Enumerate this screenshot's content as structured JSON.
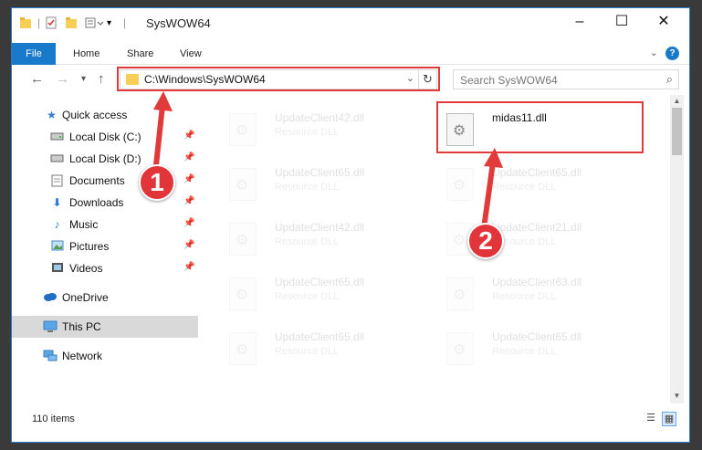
{
  "window": {
    "title": "SysWOW64",
    "tabs": [
      "File",
      "Home",
      "Share",
      "View"
    ],
    "help": "?"
  },
  "nav": {
    "address_path": "C:\\Windows\\SysWOW64",
    "search_placeholder": "Search SysWOW64"
  },
  "sidebar": {
    "items": [
      {
        "label": "Quick access",
        "icon": "star-icon"
      },
      {
        "label": "Local Disk (C:)",
        "icon": "drive-icon",
        "pinned": true
      },
      {
        "label": "Local Disk (D:)",
        "icon": "drive-icon",
        "pinned": true
      },
      {
        "label": "Documents",
        "icon": "documents-icon",
        "pinned": true
      },
      {
        "label": "Downloads",
        "icon": "downloads-icon",
        "pinned": true
      },
      {
        "label": "Music",
        "icon": "music-icon",
        "pinned": true
      },
      {
        "label": "Pictures",
        "icon": "pictures-icon",
        "pinned": true
      },
      {
        "label": "Videos",
        "icon": "videos-icon",
        "pinned": true
      },
      {
        "label": "OneDrive",
        "icon": "onedrive-icon"
      },
      {
        "label": "This PC",
        "icon": "computer-icon"
      },
      {
        "label": "Network",
        "icon": "network-icon"
      }
    ]
  },
  "files": [
    {
      "name": "UpdateClient42.dll",
      "type": "Resource DLL"
    },
    {
      "name": "midas11.dll",
      "type": ""
    },
    {
      "name": "UpdateClient65.dll",
      "type": "Resource DLL"
    },
    {
      "name": "UpdateClient65.dll",
      "type": "Resource DLL"
    },
    {
      "name": "UpdateClient42.dll",
      "type": "Resource DLL"
    },
    {
      "name": "UpdateClient21.dll",
      "type": "Resource DLL"
    },
    {
      "name": "UpdateClient65.dll",
      "type": "Resource DLL"
    },
    {
      "name": "UpdateClient63.dll",
      "type": "Resource DLL"
    },
    {
      "name": "UpdateClient65.dll",
      "type": "Resource DLL"
    },
    {
      "name": "UpdateClient65.dll",
      "type": "Resource DLL"
    }
  ],
  "status": {
    "item_count": "110 items"
  },
  "annotations": {
    "step1": "1",
    "step2": "2",
    "color": "#e03a3a"
  }
}
